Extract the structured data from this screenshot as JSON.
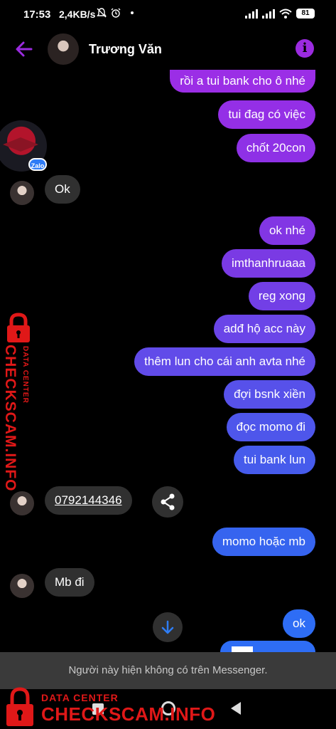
{
  "status_bar": {
    "time": "17:53",
    "network_speed": "2,4KB/s",
    "battery": "81"
  },
  "header": {
    "contact_name": "Trương Văn",
    "info_glyph": "i"
  },
  "colors": {
    "accent_purple": "#9b2be0",
    "bubble_top": "#8a2be2",
    "bubble_bottom": "#2e6df5",
    "incoming_bubble": "#303030",
    "watermark_red": "#e01818"
  },
  "zalo_badge": "Zalo",
  "messages": [
    {
      "dir": "out",
      "text": "rồi a tui bank cho ô nhé",
      "color": "#9b2ee6"
    },
    {
      "dir": "out",
      "text": "tui đag có việc",
      "color": "#942fe6"
    },
    {
      "dir": "out",
      "text": "chốt 20con",
      "color": "#8e31e6"
    },
    {
      "dir": "in",
      "text": "Ok"
    },
    {
      "dir": "out",
      "text": "ok nhé",
      "color": "#8236e4"
    },
    {
      "dir": "out",
      "text": "imthanhruaaa",
      "color": "#7a3ae4"
    },
    {
      "dir": "out",
      "text": "reg xong",
      "color": "#723fe6"
    },
    {
      "dir": "out",
      "text": "adđ hộ acc này",
      "color": "#6a45e8"
    },
    {
      "dir": "out",
      "text": "thêm lun cho cái anh avta nhé",
      "color": "#614be9"
    },
    {
      "dir": "out",
      "text": "đợi bsnk xiền",
      "color": "#5751ea"
    },
    {
      "dir": "out",
      "text": "đọc momo đi",
      "color": "#4e56eb"
    },
    {
      "dir": "out",
      "text": "tui bank lun",
      "color": "#465bec"
    },
    {
      "dir": "in",
      "text": "0792144346"
    },
    {
      "dir": "out",
      "text": "momo hoặc mb",
      "color": "#3664ef"
    },
    {
      "dir": "in",
      "text": "Mb đi"
    },
    {
      "dir": "out",
      "text": "ok",
      "color": "#2e6df5"
    }
  ],
  "notice": "Người này hiện không có trên Messenger.",
  "watermark": {
    "small": "DATA CENTER",
    "big": "CHECKSCAM.INFO"
  }
}
